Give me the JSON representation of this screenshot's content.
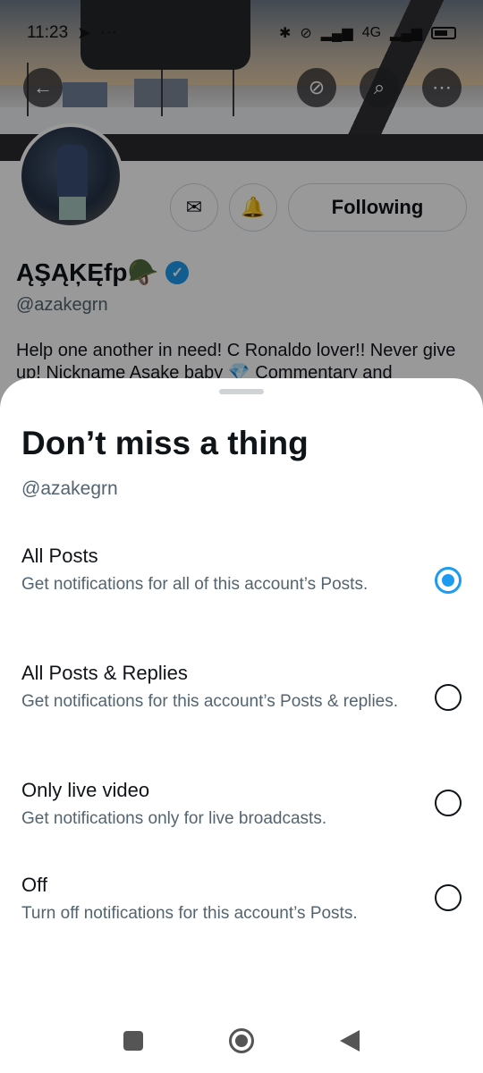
{
  "status_bar": {
    "time": "11:23",
    "network": "4G"
  },
  "profile": {
    "display_name": "ĄŞĄĶĘfp🪖",
    "handle": "@azakegrn",
    "bio": "Help one another in need! C Ronaldo lover!! Never give up! Nickname Asake baby 💎 Commentary and",
    "following_label": "Following",
    "icons": [
      "back-arrow-icon",
      "retweet-off-icon",
      "search-icon",
      "more-icon",
      "mail-icon",
      "bell-notify-icon",
      "verified-badge-icon"
    ]
  },
  "sheet": {
    "title": "Don’t miss a thing",
    "handle": "@azakegrn",
    "options": [
      {
        "title": "All Posts",
        "description": "Get notifications for all of this account’s Posts.",
        "selected": true
      },
      {
        "title": "All Posts & Replies",
        "description": "Get notifications for this account’s Posts & replies.",
        "selected": false
      },
      {
        "title": "Only live video",
        "description": "Get notifications only for live broadcasts.",
        "selected": false
      },
      {
        "title": "Off",
        "description": "Turn off notifications for this account’s Posts.",
        "selected": false
      }
    ]
  },
  "colors": {
    "accent": "#1d9bf0",
    "text": "#0f1419",
    "muted": "#536471"
  }
}
